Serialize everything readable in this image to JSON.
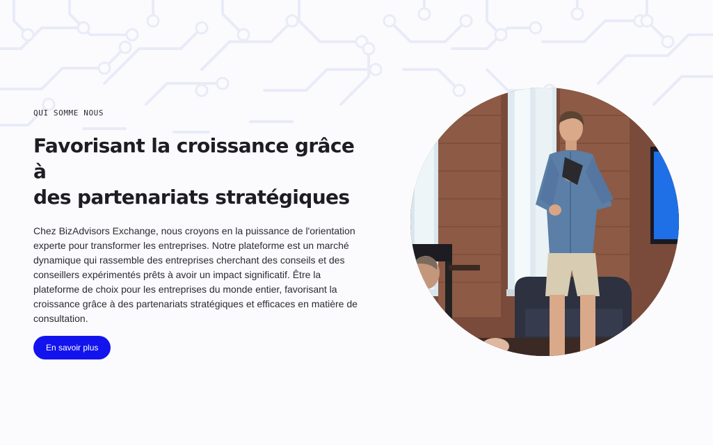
{
  "about": {
    "eyebrow": "QUI SOMME NOUS",
    "headline_line1": "Favorisant la croissance grâce à",
    "headline_line2": "des partenariats stratégiques",
    "body": "Chez BizAdvisors Exchange, nous croyons en la puissance de l'orientation experte pour transformer les entreprises. Notre plateforme est un marché dynamique qui rassemble des entreprises cherchant des conseils et des conseillers expérimentés prêts à avoir un impact significatif. Être la plateforme de choix pour les entreprises du monde entier, favorisant la croissance grâce à des partenariats stratégiques et efficaces en matière de consultation.",
    "cta_label": "En savoir plus"
  },
  "colors": {
    "accent": "#1313ee",
    "background": "#fbfbfe",
    "circuit": "#e9ebf7"
  }
}
